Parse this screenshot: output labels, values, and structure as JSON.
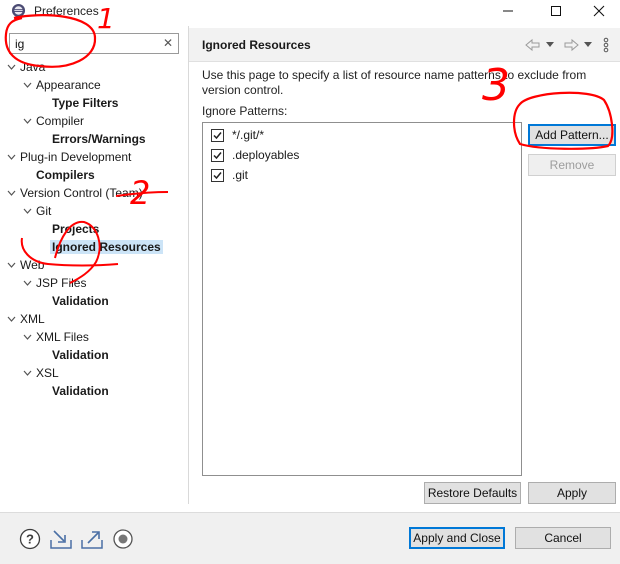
{
  "window": {
    "title": "Preferences"
  },
  "filter": {
    "value": "ig",
    "clear_glyph": "✕"
  },
  "tree": [
    {
      "label": "Java",
      "bold": false,
      "twisty": "down"
    },
    {
      "label": "Appearance",
      "bold": false,
      "twisty": "down"
    },
    {
      "label": "Type Filters",
      "bold": true,
      "twisty": "none"
    },
    {
      "label": "Compiler",
      "bold": false,
      "twisty": "down"
    },
    {
      "label": "Errors/Warnings",
      "bold": true,
      "twisty": "none"
    },
    {
      "label": "Plug-in Development",
      "bold": false,
      "twisty": "down"
    },
    {
      "label": "Compilers",
      "bold": true,
      "twisty": "none"
    },
    {
      "label": "Version Control (Team)",
      "bold": false,
      "twisty": "down"
    },
    {
      "label": "Git",
      "bold": false,
      "twisty": "down"
    },
    {
      "label": "Projects",
      "bold": true,
      "twisty": "none"
    },
    {
      "label": "Ignored Resources",
      "bold": true,
      "twisty": "none",
      "selected": true
    },
    {
      "label": "Web",
      "bold": false,
      "twisty": "down"
    },
    {
      "label": "JSP Files",
      "bold": false,
      "twisty": "down"
    },
    {
      "label": "Validation",
      "bold": true,
      "twisty": "none"
    },
    {
      "label": "XML",
      "bold": false,
      "twisty": "down"
    },
    {
      "label": "XML Files",
      "bold": false,
      "twisty": "down"
    },
    {
      "label": "Validation",
      "bold": true,
      "twisty": "none"
    },
    {
      "label": "XSL",
      "bold": false,
      "twisty": "down"
    },
    {
      "label": "Validation",
      "bold": true,
      "twisty": "none"
    }
  ],
  "page": {
    "title": "Ignored Resources",
    "description": "Use this page to specify a list of resource name patterns to exclude from version control.",
    "patterns_label": "Ignore Patterns:",
    "patterns": [
      {
        "text": "*/.git/*",
        "checked": true
      },
      {
        "text": ".deployables",
        "checked": true
      },
      {
        "text": ".git",
        "checked": true
      }
    ],
    "add_pattern": "Add Pattern...",
    "remove": "Remove",
    "restore_defaults": "Restore Defaults",
    "apply": "Apply"
  },
  "footer": {
    "apply_and_close": "Apply and Close",
    "cancel": "Cancel",
    "icons": [
      "help-icon",
      "import-icon",
      "export-icon",
      "record-icon"
    ]
  },
  "annotations": {
    "color": "#ff0000",
    "marks": [
      "1",
      "2",
      "3"
    ]
  }
}
